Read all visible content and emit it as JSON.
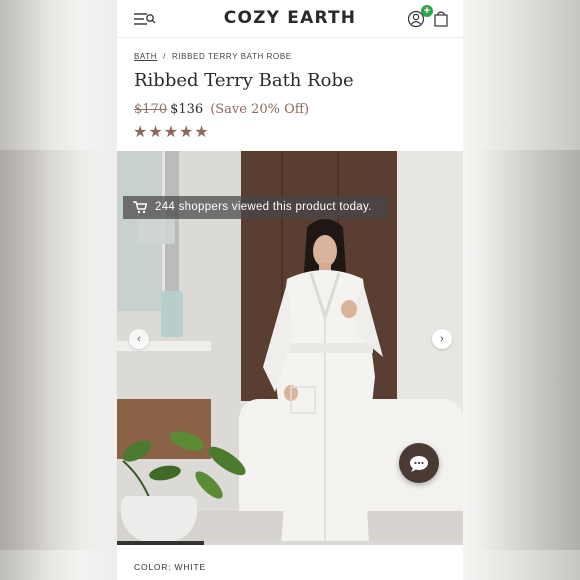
{
  "header": {
    "brand": "COZY EARTH",
    "menu_icon": "menu-search-icon",
    "account_icon": "user-icon",
    "badge_text": "+",
    "cart_icon": "shopping-bag-icon"
  },
  "breadcrumb": {
    "items": [
      "BATH",
      "RIBBED TERRY BATH ROBE"
    ],
    "separator": "/"
  },
  "product": {
    "title": "Ribbed Terry Bath Robe",
    "original_price": "$170",
    "sale_price": "$136",
    "savings": "(Save 20% Off)",
    "rating_stars": "★★★★★",
    "rating": 5
  },
  "gallery": {
    "banner_text": "244 shoppers viewed this product today.",
    "banner_icon": "cart-icon",
    "prev_icon": "chevron-left-icon",
    "next_icon": "chevron-right-icon",
    "chat_icon": "chat-dots-icon",
    "progress_fraction": 0.25
  },
  "options": {
    "color_label": "COLOR: WHITE"
  },
  "colors": {
    "accent_brown": "#8a6a5c",
    "badge_green": "#2fa64a",
    "chat_bg": "#4b3a34"
  }
}
